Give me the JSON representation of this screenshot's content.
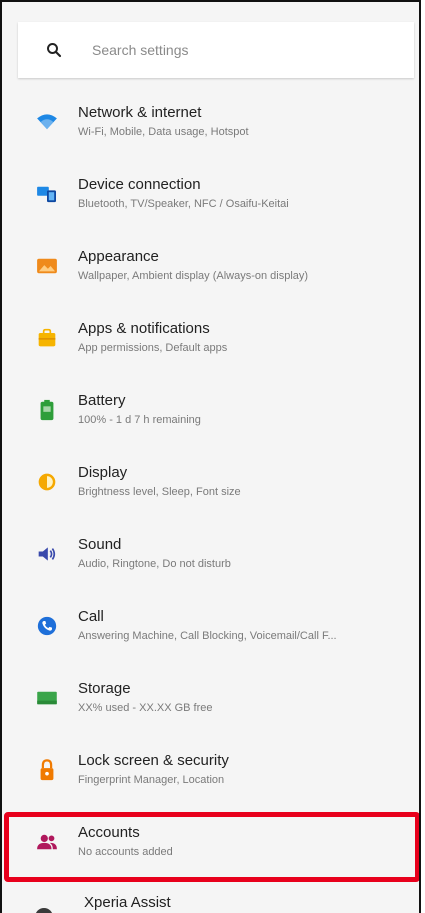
{
  "search": {
    "placeholder": "Search settings"
  },
  "items": [
    {
      "title": "Network & internet",
      "summary": "Wi-Fi, Mobile, Data usage, Hotspot",
      "icon": "wifi-icon",
      "color": "#1e88e5"
    },
    {
      "title": "Device connection",
      "summary": "Bluetooth, TV/Speaker, NFC / Osaifu-Keitai",
      "icon": "devices-icon",
      "color": "#1e88e5"
    },
    {
      "title": "Appearance",
      "summary": "Wallpaper, Ambient display (Always-on display)",
      "icon": "wallpaper-icon",
      "color": "#ef8a1b"
    },
    {
      "title": "Apps & notifications",
      "summary": "App permissions, Default apps",
      "icon": "apps-icon",
      "color": "#f6b400"
    },
    {
      "title": "Battery",
      "summary": "100% - 1 d 7 h remaining",
      "icon": "battery-icon",
      "color": "#2e9e3a"
    },
    {
      "title": "Display",
      "summary": "Brightness level, Sleep, Font size",
      "icon": "brightness-icon",
      "color": "#f5a800"
    },
    {
      "title": "Sound",
      "summary": "Audio, Ringtone, Do not disturb",
      "icon": "volume-icon",
      "color": "#3949ab"
    },
    {
      "title": "Call",
      "summary": "Answering Machine, Call Blocking, Voicemail/Call F...",
      "icon": "phone-icon",
      "color": "#1e6fd9"
    },
    {
      "title": "Storage",
      "summary": "XX% used - XX.XX GB free",
      "icon": "storage-icon",
      "color": "#3aa54a"
    },
    {
      "title": "Lock screen & security",
      "summary": "Fingerprint Manager, Location",
      "icon": "lock-icon",
      "color": "#f07a00"
    },
    {
      "title": "Accounts",
      "summary": "No accounts added",
      "icon": "accounts-icon",
      "color": "#b0185c"
    }
  ],
  "partial_item": {
    "title": "Xperia Assist"
  },
  "colors": {
    "highlight": "#e8001c",
    "background": "#f5f5f5"
  }
}
